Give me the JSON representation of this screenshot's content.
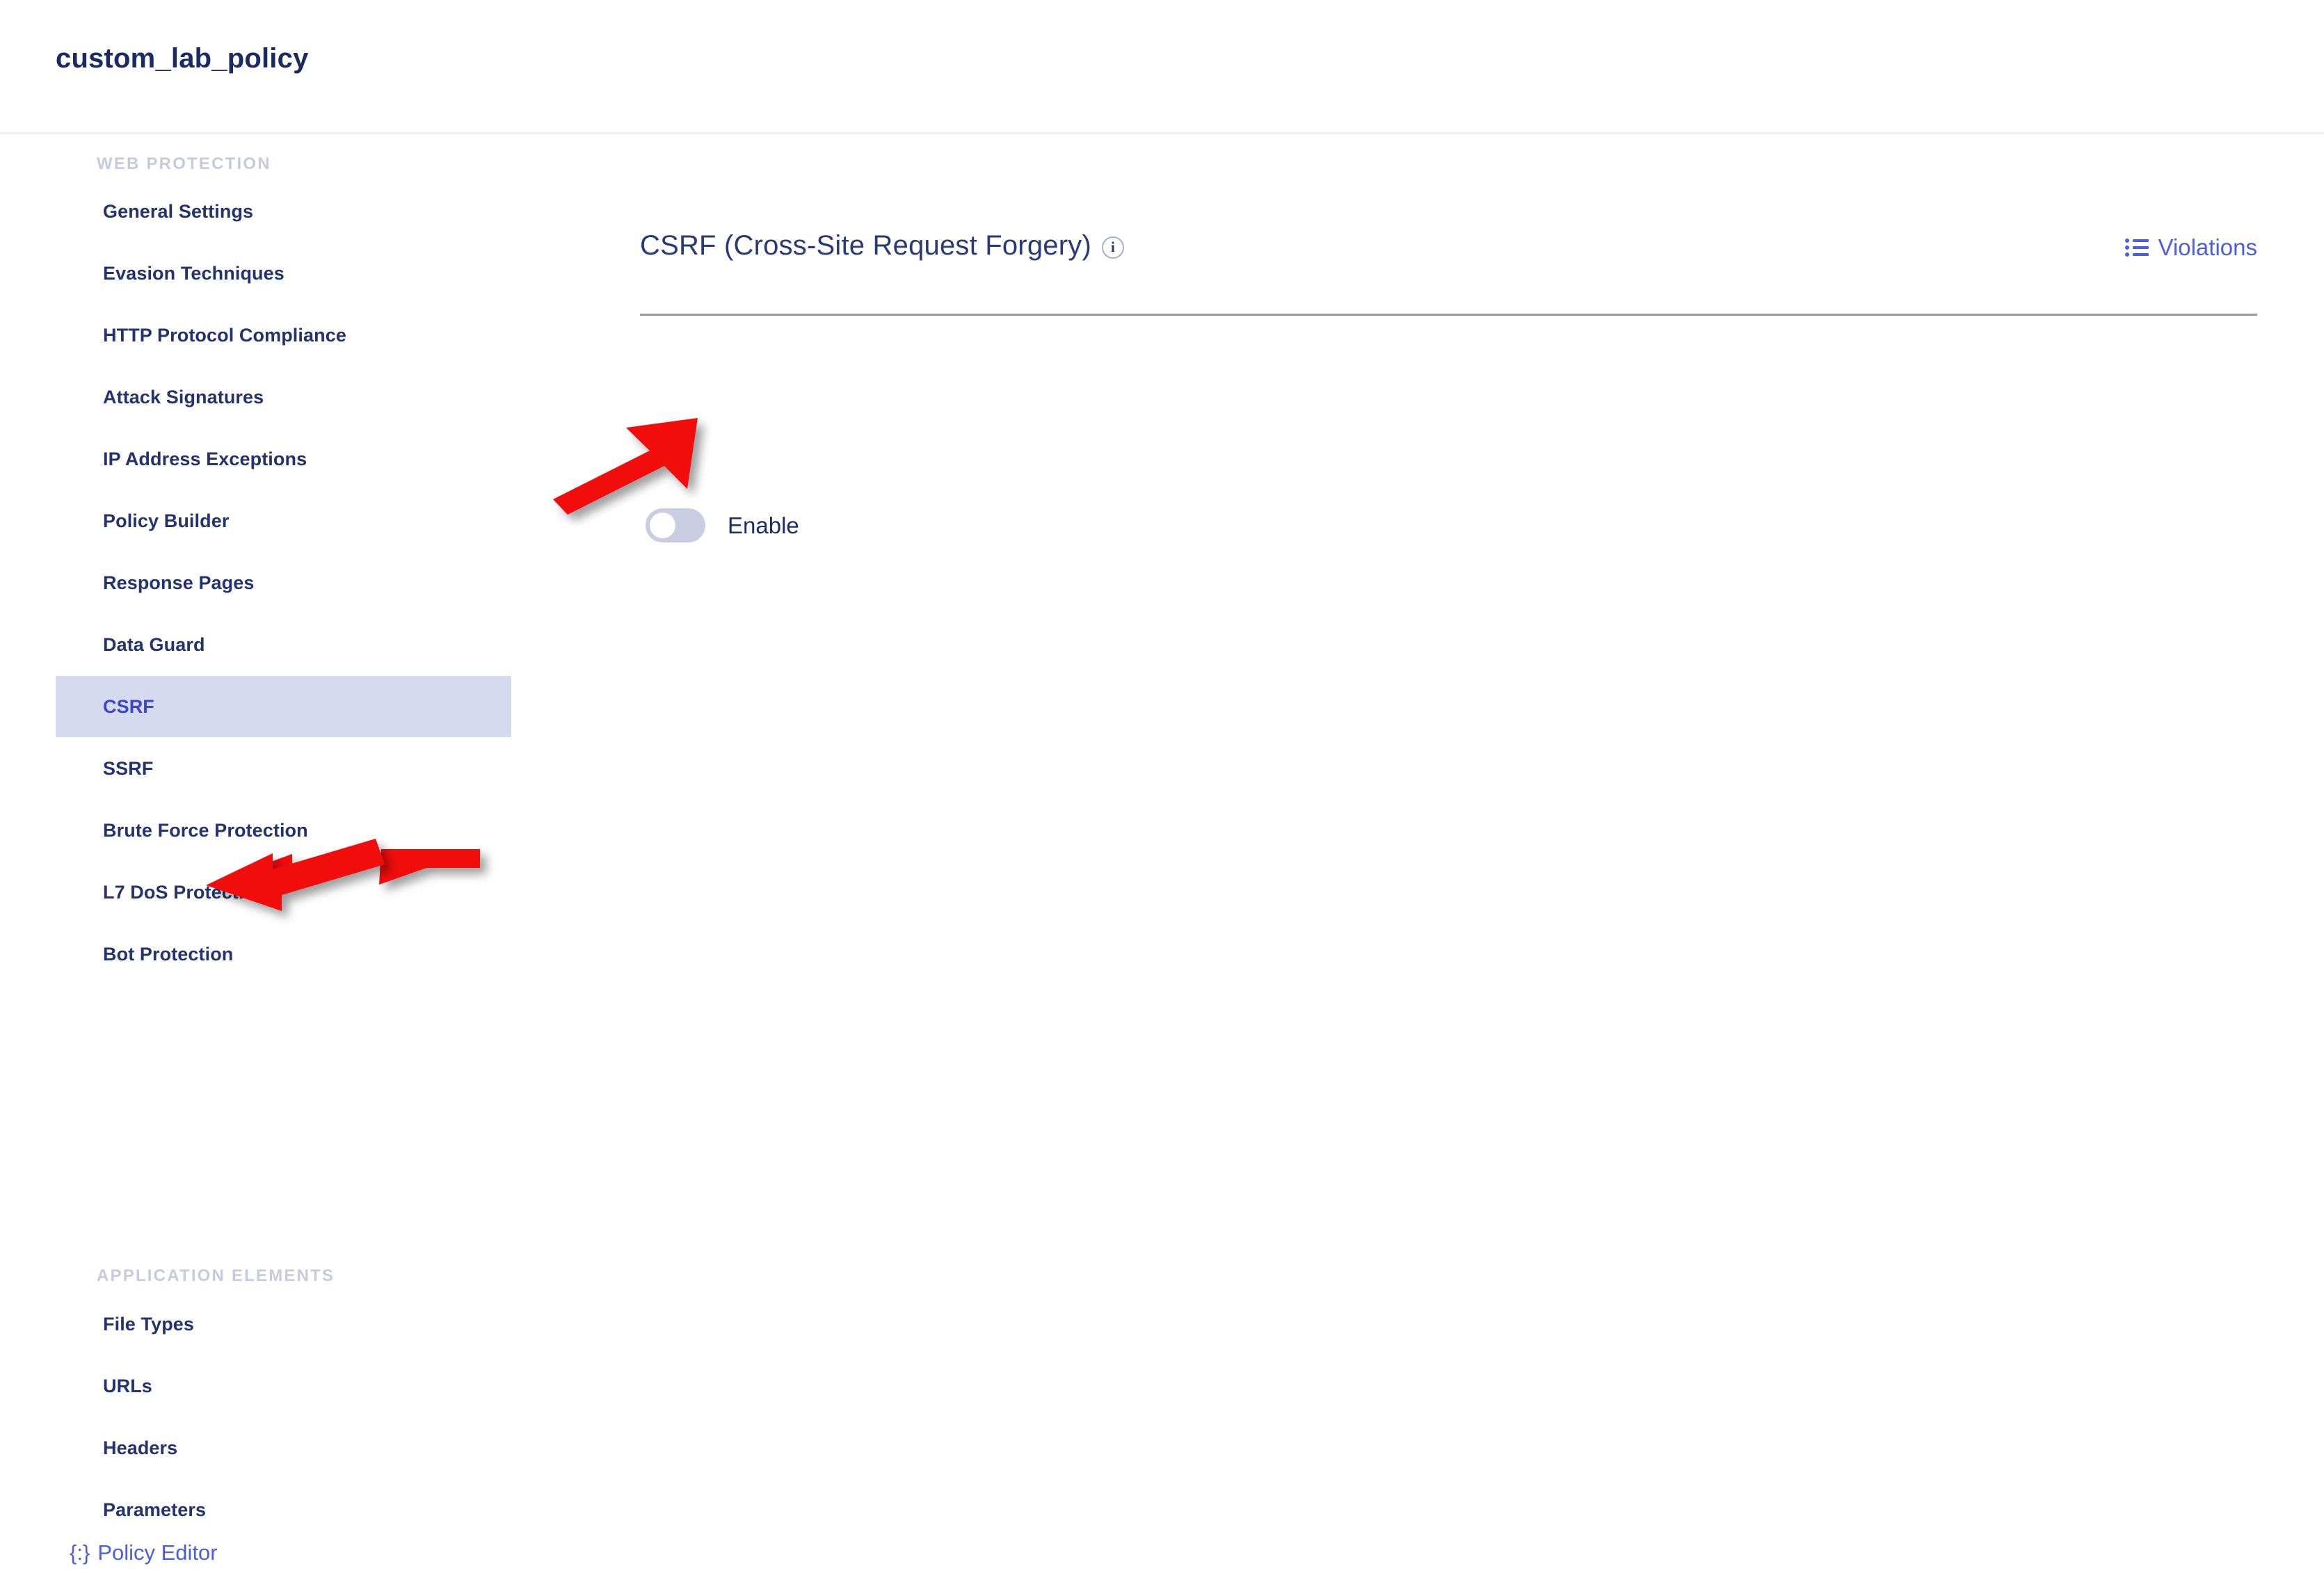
{
  "header": {
    "policy_title": "custom_lab_policy"
  },
  "sidebar": {
    "groups": [
      {
        "label": "WEB PROTECTION",
        "items": [
          {
            "label": "General Settings",
            "active": false
          },
          {
            "label": "Evasion Techniques",
            "active": false
          },
          {
            "label": "HTTP Protocol Compliance",
            "active": false
          },
          {
            "label": "Attack Signatures",
            "active": false
          },
          {
            "label": "IP Address Exceptions",
            "active": false
          },
          {
            "label": "Policy Builder",
            "active": false
          },
          {
            "label": "Response Pages",
            "active": false
          },
          {
            "label": "Data Guard",
            "active": false
          },
          {
            "label": "CSRF",
            "active": true
          },
          {
            "label": "SSRF",
            "active": false
          },
          {
            "label": "Brute Force Protection",
            "active": false
          },
          {
            "label": "L7 DoS Protection",
            "active": false
          },
          {
            "label": "Bot Protection",
            "active": false
          }
        ]
      },
      {
        "label": "APPLICATION ELEMENTS",
        "items": [
          {
            "label": "File Types",
            "active": false
          },
          {
            "label": "URLs",
            "active": false
          },
          {
            "label": "Headers",
            "active": false
          },
          {
            "label": "Parameters",
            "active": false
          }
        ]
      }
    ],
    "policy_editor": {
      "glyph": "{:}",
      "label": "Policy Editor"
    }
  },
  "main": {
    "section_title": "CSRF (Cross-Site Request Forgery)",
    "info_glyph": "i",
    "violations_label": "Violations",
    "enable_label": "Enable",
    "enable_state": "off"
  },
  "colors": {
    "accent_link": "#4b5ee0",
    "title_navy": "#1b2a63",
    "nav_text": "#233270",
    "active_bg": "#d6daee",
    "active_text": "#3c46c8",
    "group_label": "#c6cadd",
    "toggle_off_track": "#c9cde1",
    "annotation_arrow": "#f20d0d",
    "rule": "#9a9a9a"
  }
}
